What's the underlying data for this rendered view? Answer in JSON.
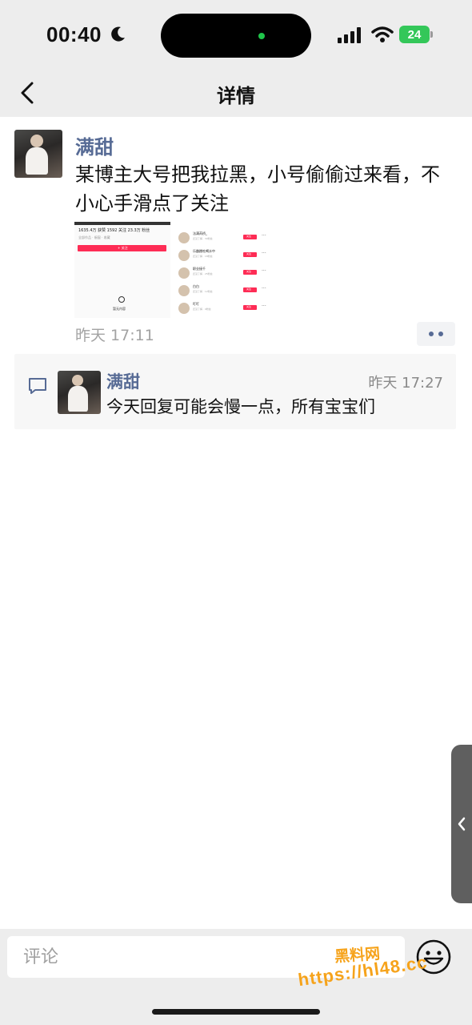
{
  "status_bar": {
    "time": "00:40",
    "battery": "24"
  },
  "nav": {
    "title": "详情"
  },
  "post": {
    "author": "满甜",
    "text": "某博主大号把我拉黑，小号偷偷过来看，不小心手滑点了关注",
    "time": "昨天 17:11",
    "image": {
      "stats": "1635.4万 获赞    1592 关注    23.3万 粉丝",
      "profile_sub": "全部作品 · 橱窗 · 收藏",
      "profile_button": "+ 关注",
      "blocked_text": "暂无内容",
      "follow_list": [
        {
          "name": "法满芮桥_",
          "sub": "还没了解 · 30粉丝",
          "button": "关注"
        },
        {
          "name": "乐趣蹭吃喝水中",
          "sub": "还没了解 · 18粉丝",
          "button": "关注"
        },
        {
          "name": "职业接千",
          "sub": "还没了解 · 25粉丝",
          "button": "关注"
        },
        {
          "name": "白白",
          "sub": "还没了解 · 12粉丝",
          "button": "关注"
        },
        {
          "name": "叮叮",
          "sub": "还没了解 · 9粉丝",
          "button": "关注"
        }
      ]
    }
  },
  "comment": {
    "author": "满甜",
    "time": "昨天 17:27",
    "text": "今天回复可能会慢一点，所有宝宝们"
  },
  "input": {
    "placeholder": "评论"
  },
  "watermark": {
    "line1": "黑料网",
    "line2": "https://hl48.cc"
  },
  "colors": {
    "link_blue": "#576b95",
    "header_bg": "#ededed",
    "battery_green": "#34c759",
    "accent_red": "#fe2c55",
    "watermark_orange": "#f6a31b"
  }
}
